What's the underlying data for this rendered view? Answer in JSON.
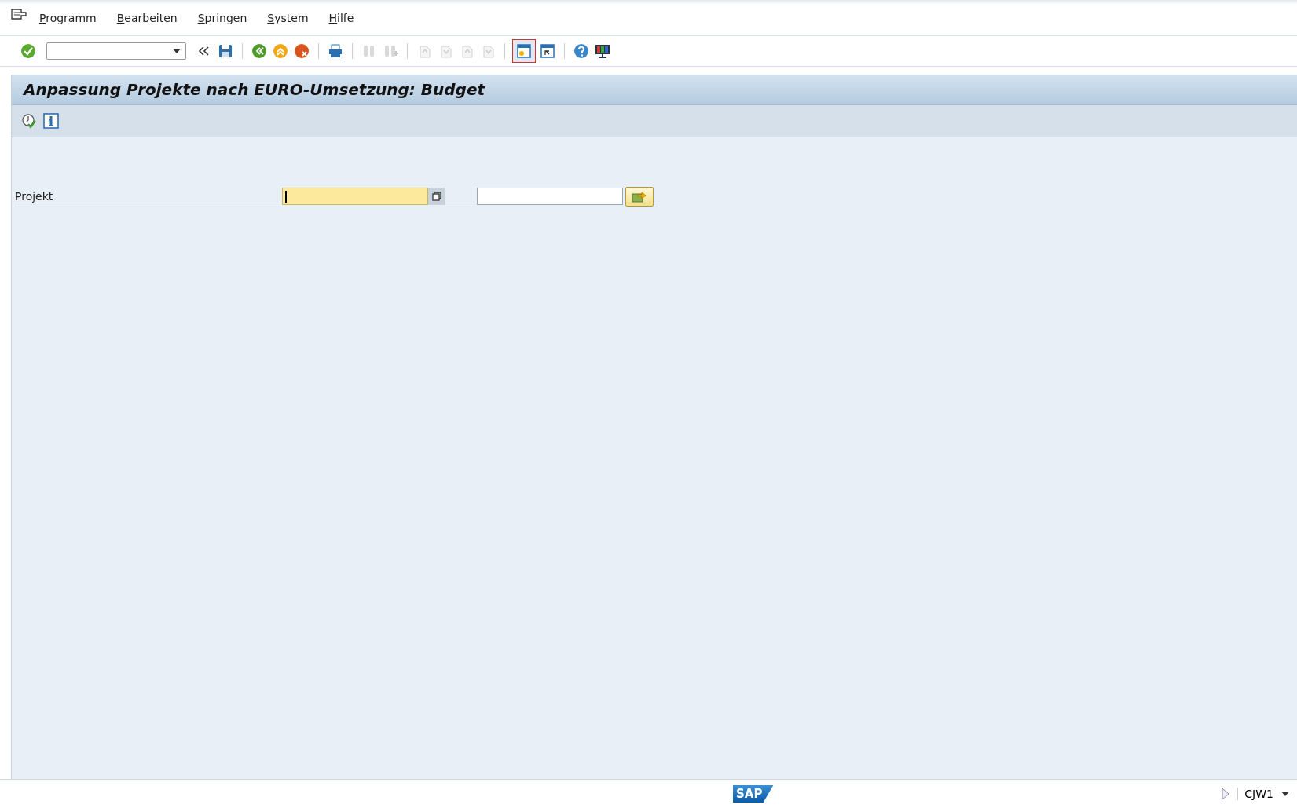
{
  "menu": [
    {
      "label": "Programm"
    },
    {
      "label": "Bearbeiten"
    },
    {
      "label": "Springen"
    },
    {
      "label": "System"
    },
    {
      "label": "Hilfe"
    }
  ],
  "toolbar": {
    "buttons": [
      {
        "disabled": false,
        "focused": false
      },
      {
        "disabled": false,
        "focused": false
      },
      {
        "disabled": false,
        "focused": false
      },
      {
        "disabled": false,
        "focused": false
      },
      {
        "disabled": false,
        "focused": false
      },
      {
        "disabled": false,
        "focused": false
      },
      {
        "disabled": false,
        "focused": false
      },
      {
        "disabled": true,
        "focused": false
      },
      {
        "disabled": true,
        "focused": false
      },
      {
        "disabled": true,
        "focused": false
      },
      {
        "disabled": true,
        "focused": false
      },
      {
        "disabled": true,
        "focused": false
      },
      {
        "disabled": true,
        "focused": false
      },
      {
        "disabled": false,
        "focused": true
      },
      {
        "disabled": false,
        "focused": false
      },
      {
        "disabled": false,
        "focused": false
      },
      {
        "disabled": false,
        "focused": false
      }
    ]
  },
  "title": "Anpassung Projekte nach EURO-Umsetzung: Budget",
  "form": {
    "fields": [
      {
        "label": "Projekt",
        "from": {
          "focused": true
        },
        "to": {
          "focused": false
        }
      }
    ]
  },
  "status_bar": {
    "logo": "SAP",
    "transaction": "CJW1"
  }
}
